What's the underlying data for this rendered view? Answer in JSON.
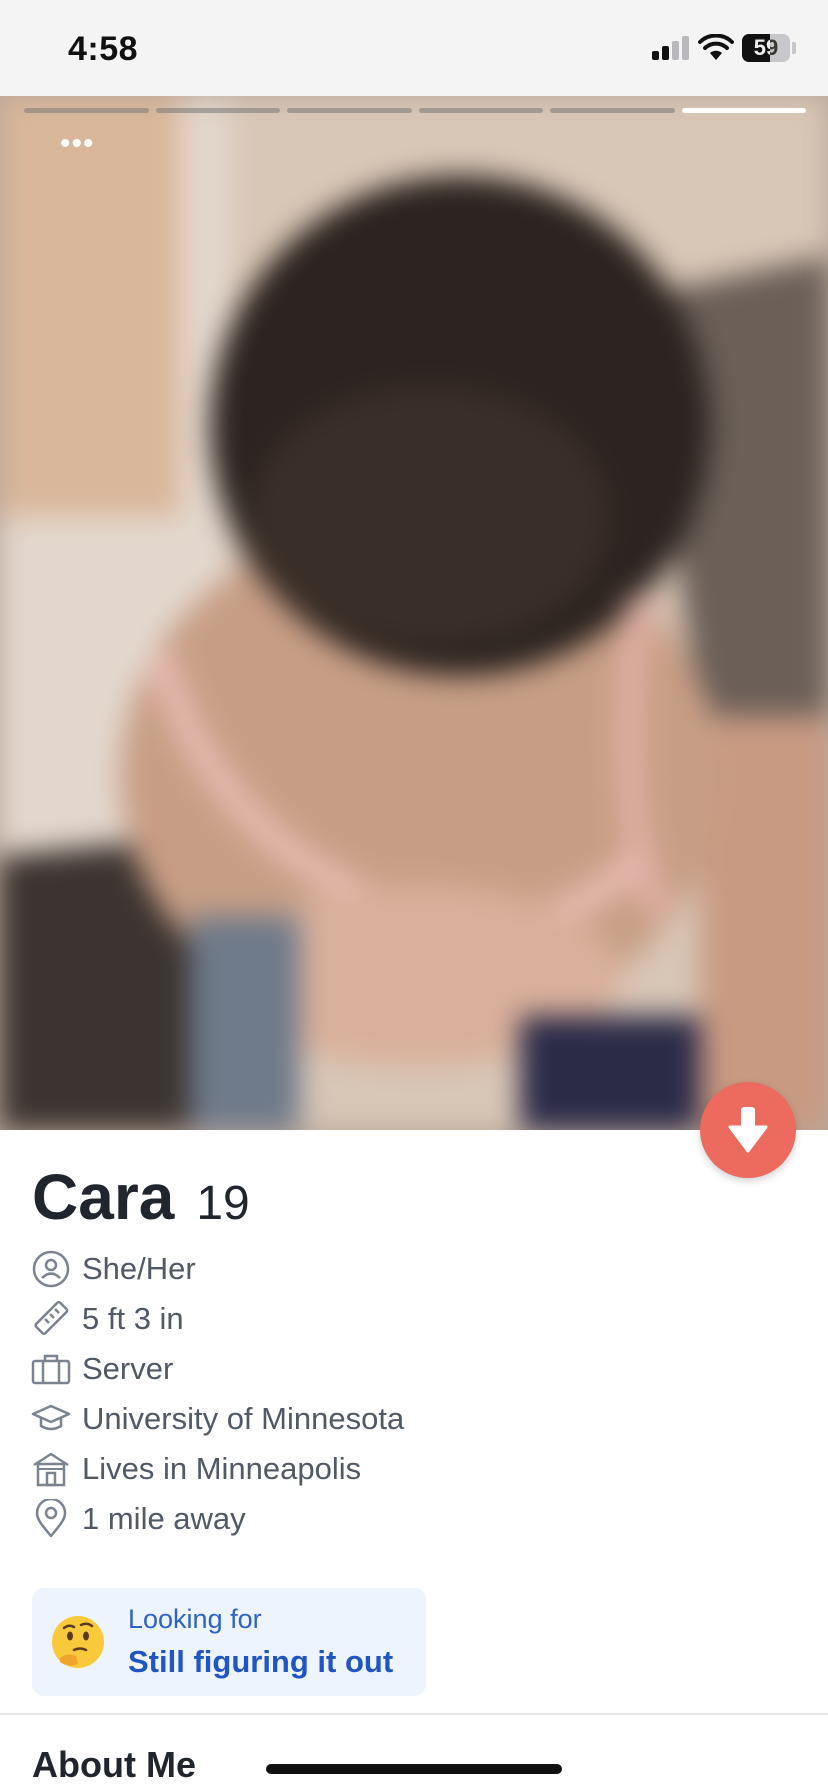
{
  "status_bar": {
    "time": "4:58",
    "battery_level": "59",
    "battery_percent": 59,
    "signal_bars_active": 2,
    "signal_bars_total": 4
  },
  "photo": {
    "photo_count": 6,
    "active_photo_index": 5,
    "more_options_icon": "more-dots-icon",
    "dislike_icon": "arrow-down-icon",
    "dislike_color": "#ec6a5e"
  },
  "profile": {
    "name": "Cara",
    "age": "19",
    "details": [
      {
        "icon": "person-icon",
        "text": "She/Her"
      },
      {
        "icon": "ruler-icon",
        "text": "5 ft 3 in"
      },
      {
        "icon": "briefcase-icon",
        "text": "Server"
      },
      {
        "icon": "graduation-cap-icon",
        "text": "University of Minnesota"
      },
      {
        "icon": "house-icon",
        "text": "Lives in Minneapolis"
      },
      {
        "icon": "location-pin-icon",
        "text": "1 mile away"
      }
    ]
  },
  "looking_for": {
    "emoji": "thinking-face-emoji",
    "label": "Looking for",
    "value": "Still figuring it out",
    "accent": "#1f55c4"
  },
  "about": {
    "title": "About Me"
  }
}
